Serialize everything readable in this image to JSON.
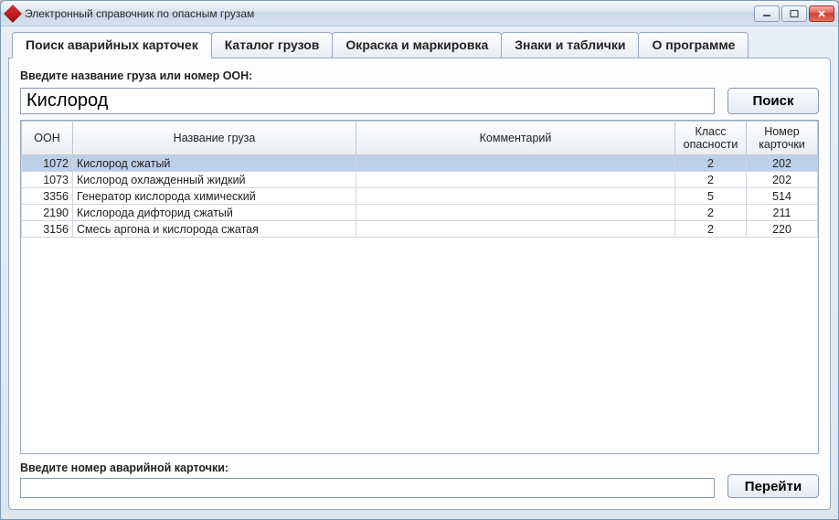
{
  "window": {
    "title": "Электронный справочник по опасным грузам"
  },
  "tabs": {
    "items": [
      {
        "label": "Поиск аварийных карточек",
        "active": true
      },
      {
        "label": "Каталог грузов",
        "active": false
      },
      {
        "label": "Окраска и маркировка",
        "active": false
      },
      {
        "label": "Знаки и таблички",
        "active": false
      },
      {
        "label": "О программе",
        "active": false
      }
    ]
  },
  "search": {
    "prompt": "Введите название груза или номер ООН:",
    "value": "Кислород",
    "button": "Поиск"
  },
  "grid": {
    "columns": {
      "oon": "ООН",
      "name": "Название груза",
      "comment": "Комментарий",
      "class": "Класс опасности",
      "card": "Номер карточки"
    },
    "rows": [
      {
        "oon": "1072",
        "name": "Кислород сжатый",
        "comment": "",
        "class": "2",
        "card": "202",
        "selected": true
      },
      {
        "oon": "1073",
        "name": "Кислород охлажденный жидкий",
        "comment": "",
        "class": "2",
        "card": "202",
        "selected": false
      },
      {
        "oon": "3356",
        "name": "Генератор кислорода химический",
        "comment": "",
        "class": "5",
        "card": "514",
        "selected": false
      },
      {
        "oon": "2190",
        "name": "Кислорода дифторид сжатый",
        "comment": "",
        "class": "2",
        "card": "211",
        "selected": false
      },
      {
        "oon": "3156",
        "name": "Смесь аргона и кислорода сжатая",
        "comment": "",
        "class": "2",
        "card": "220",
        "selected": false
      }
    ]
  },
  "bottom": {
    "prompt": "Введите номер аварийной карточки:",
    "value": "",
    "button": "Перейти"
  }
}
